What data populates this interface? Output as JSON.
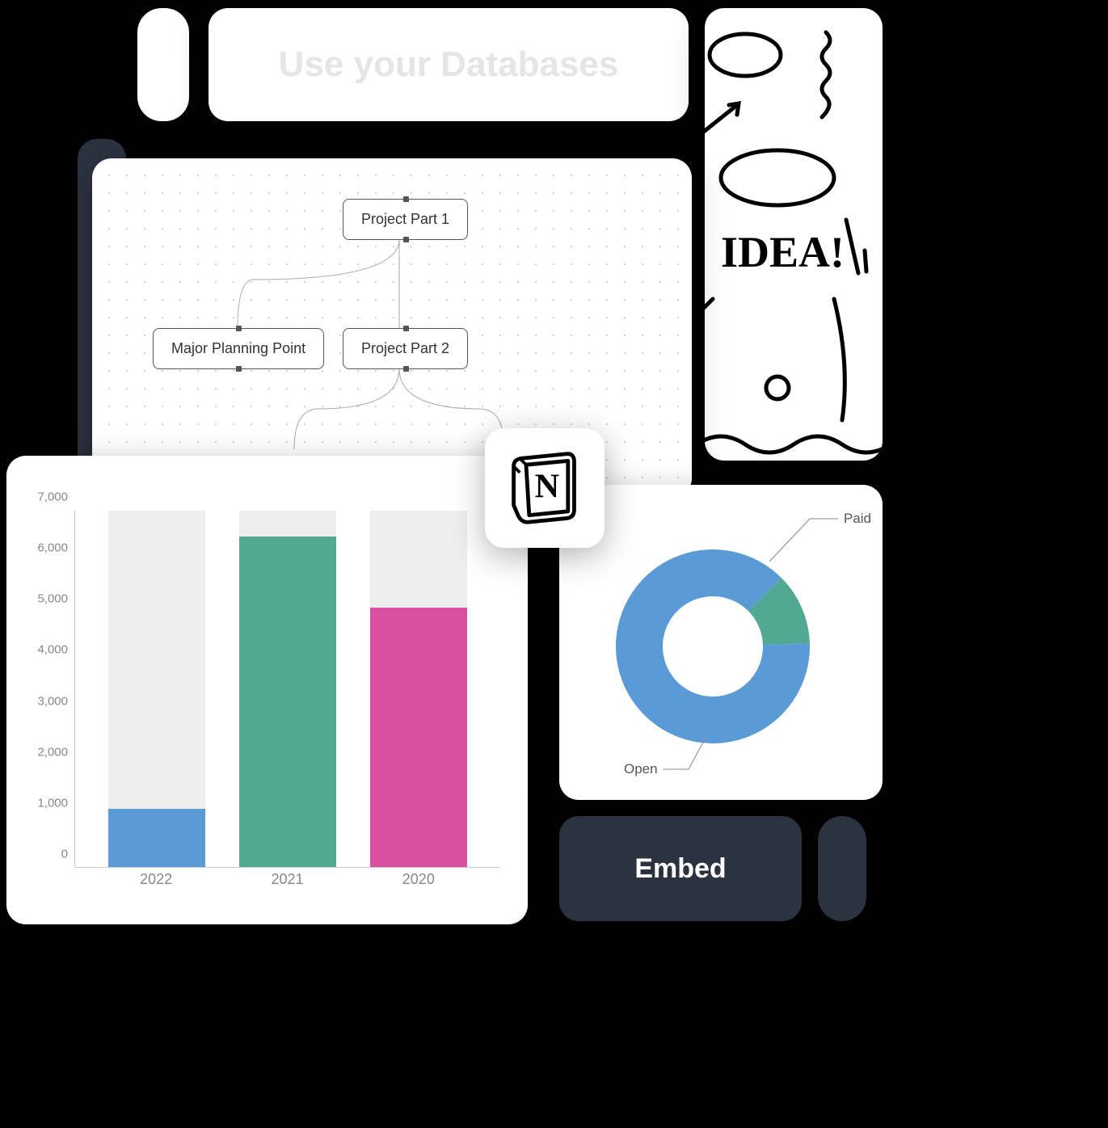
{
  "header": {
    "title": "Use your Databases"
  },
  "idea": {
    "text": "IDEA!"
  },
  "diagram": {
    "nodes": {
      "n1": "Project Part 1",
      "n2": "Major Planning Point",
      "n3": "Project Part 2"
    }
  },
  "notion": {
    "letter": "N"
  },
  "embed": {
    "label": "Embed"
  },
  "donut": {
    "labels": {
      "paid": "Paid",
      "open": "Open"
    }
  },
  "chart_data": [
    {
      "type": "bar",
      "title": "",
      "xlabel": "",
      "ylabel": "",
      "categories": [
        "2022",
        "2021",
        "2020"
      ],
      "values": [
        1150,
        6500,
        5100
      ],
      "bg_values": [
        7000,
        7000,
        7000
      ],
      "colors": [
        "#5a9bd5",
        "#52a993",
        "#d84fa2"
      ],
      "ylim": [
        0,
        7000
      ],
      "yticks": [
        0,
        1000,
        2000,
        3000,
        4000,
        5000,
        6000,
        7000
      ]
    },
    {
      "type": "pie",
      "title": "",
      "series": [
        {
          "name": "Paid",
          "value": 12,
          "color": "#52a993"
        },
        {
          "name": "Open",
          "value": 88,
          "color": "#5a9bd5"
        }
      ]
    }
  ]
}
